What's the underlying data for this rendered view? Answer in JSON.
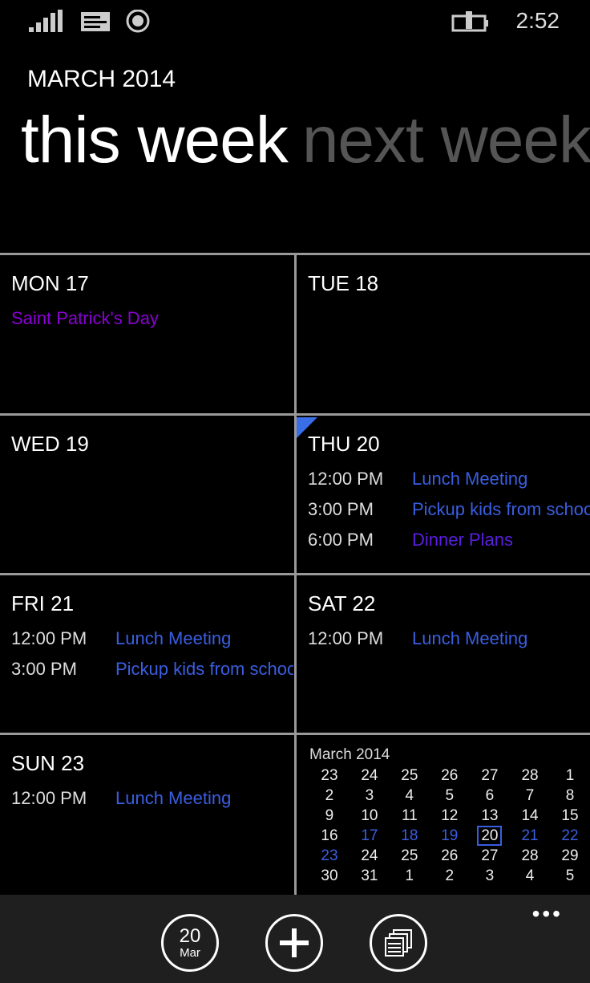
{
  "status": {
    "time": "2:52",
    "icons": [
      "signal-icon",
      "message-icon",
      "location-icon",
      "battery-charging-icon"
    ]
  },
  "header": {
    "month": "MARCH 2014",
    "pivot_active": "this week",
    "pivot_next": "next week"
  },
  "colors": {
    "accent": "#3a5ee0",
    "holiday": "#8a00d4",
    "dinner": "#5a1ee0"
  },
  "days": [
    {
      "label": "MON 17",
      "events": [
        {
          "time": "",
          "title": "Saint Patrick's Day",
          "kind": "holiday"
        }
      ]
    },
    {
      "label": "TUE 18",
      "events": []
    },
    {
      "label": "WED 19",
      "events": []
    },
    {
      "label": "THU 20",
      "events": [
        {
          "time": "12:00 PM",
          "title": "Lunch Meeting"
        },
        {
          "time": "3:00 PM",
          "title": "Pickup kids from school"
        },
        {
          "time": "6:00 PM",
          "title": "Dinner Plans",
          "kind": "dinner"
        }
      ]
    },
    {
      "label": "FRI 21",
      "events": [
        {
          "time": "12:00 PM",
          "title": "Lunch Meeting"
        },
        {
          "time": "3:00 PM",
          "title": "Pickup kids from school"
        }
      ]
    },
    {
      "label": "SAT 22",
      "events": [
        {
          "time": "12:00 PM",
          "title": "Lunch Meeting"
        }
      ]
    },
    {
      "label": "SUN 23",
      "events": [
        {
          "time": "12:00 PM",
          "title": "Lunch Meeting"
        }
      ]
    }
  ],
  "mini_calendar": {
    "title": "March 2014",
    "today": "20",
    "current_week": [
      "17",
      "18",
      "19",
      "20",
      "21",
      "22",
      "23"
    ],
    "weeks": [
      [
        "23",
        "24",
        "25",
        "26",
        "27",
        "28",
        "1"
      ],
      [
        "2",
        "3",
        "4",
        "5",
        "6",
        "7",
        "8"
      ],
      [
        "9",
        "10",
        "11",
        "12",
        "13",
        "14",
        "15"
      ],
      [
        "16",
        "17",
        "18",
        "19",
        "20",
        "21",
        "22"
      ],
      [
        "23",
        "24",
        "25",
        "26",
        "27",
        "28",
        "29"
      ],
      [
        "30",
        "31",
        "1",
        "2",
        "3",
        "4",
        "5"
      ]
    ]
  },
  "appbar": {
    "today_day": "20",
    "today_month": "Mar",
    "more": "•••"
  }
}
